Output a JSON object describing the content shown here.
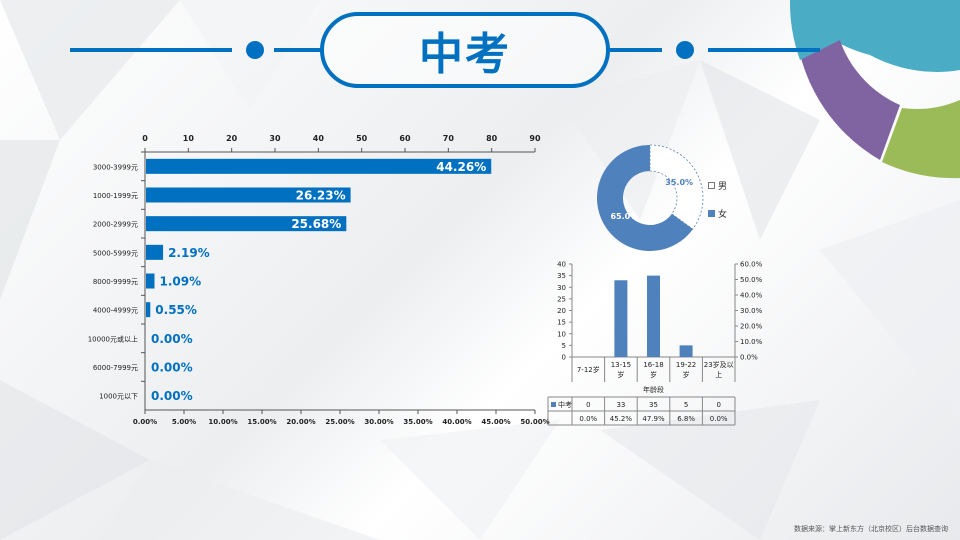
{
  "header": {
    "title": "中考"
  },
  "colors": {
    "accent": "#0070c0",
    "series_blue": "#4f81bd",
    "gray": "#8c8c8c"
  },
  "chart_data": [
    {
      "type": "bar",
      "orientation": "horizontal",
      "categories": [
        "3000-3999元",
        "1000-1999元",
        "2000-2999元",
        "5000-5999元",
        "8000-9999元",
        "4000-4999元",
        "10000元或以上",
        "6000-7999元",
        "1000元以下"
      ],
      "values": [
        44.26,
        26.23,
        25.68,
        2.19,
        1.09,
        0.55,
        0.0,
        0.0,
        0.0
      ],
      "data_labels": [
        "44.26%",
        "26.23%",
        "25.68%",
        "2.19%",
        "1.09%",
        "0.55%",
        "0.00%",
        "0.00%",
        "0.00%"
      ],
      "top_axis": {
        "min": 0,
        "max": 90,
        "ticks": [
          "0",
          "10",
          "20",
          "30",
          "40",
          "50",
          "60",
          "70",
          "80",
          "90"
        ]
      },
      "bottom_axis": {
        "min": 0,
        "max": 50,
        "ticks": [
          "0.00%",
          "5.00%",
          "10.00%",
          "15.00%",
          "20.00%",
          "25.00%",
          "30.00%",
          "35.00%",
          "40.00%",
          "45.00%",
          "50.00%"
        ]
      }
    },
    {
      "type": "pie",
      "donut": true,
      "labels": [
        "男",
        "女"
      ],
      "values": [
        35.0,
        65.0
      ],
      "data_labels": [
        "35.0%",
        "65.0%"
      ],
      "legend": "right"
    },
    {
      "type": "bar",
      "categories": [
        "7-12岁",
        "13-15岁",
        "16-18岁",
        "19-22岁",
        "23岁及以上"
      ],
      "series": [
        {
          "name": "中考",
          "values": [
            0,
            33,
            35,
            5,
            0
          ]
        }
      ],
      "percent_row": [
        "0.0%",
        "45.2%",
        "47.9%",
        "6.8%",
        "0.0%"
      ],
      "xlabel": "年龄段",
      "ylim": [
        0,
        40
      ],
      "y_ticks": [
        "0",
        "5",
        "10",
        "15",
        "20",
        "25",
        "30",
        "35",
        "40"
      ],
      "y2_ticks": [
        "0.0%",
        "10.0%",
        "20.0%",
        "30.0%",
        "40.0%",
        "50.0%",
        "60.0%"
      ],
      "data_table": true
    }
  ],
  "footer": {
    "source": "数据来源：掌上新东方（北京校区）后台数据查询"
  }
}
